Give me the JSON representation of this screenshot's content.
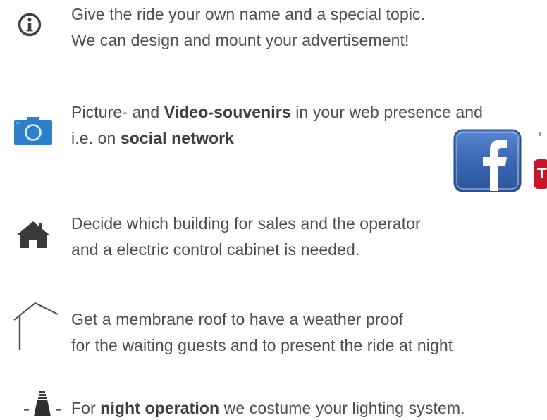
{
  "items": [
    {
      "icon": "info-icon",
      "lines": [
        [
          {
            "t": "Give the ride your own name and a special topic."
          }
        ],
        [
          {
            "t": "We can design and mount your advertisement!"
          }
        ]
      ]
    },
    {
      "icon": "camera-icon",
      "lines": [
        [
          {
            "t": "Picture- and "
          },
          {
            "t": "Video-souvenirs",
            "b": true
          },
          {
            "t": " in your web presence and"
          }
        ],
        [
          {
            "t": "i.e. on "
          },
          {
            "t": "social network",
            "b": true
          }
        ]
      ]
    },
    {
      "icon": "house-icon",
      "lines": [
        [
          {
            "t": "Decide which building for sales and the operator"
          }
        ],
        [
          {
            "t": "and a electric control cabinet is needed."
          }
        ]
      ]
    },
    {
      "icon": "roof-icon",
      "lines": [
        [
          {
            "t": "Get a membrane roof to have a weather proof"
          }
        ],
        [
          {
            "t": "for the waiting guests and to present the ride at night"
          }
        ]
      ]
    },
    {
      "icon": "lamp-icon",
      "lines": [
        [
          {
            "t": "For "
          },
          {
            "t": "night operation",
            "b": true
          },
          {
            "t": " we costume your lighting system."
          }
        ]
      ]
    }
  ],
  "social": {
    "facebook_icon": "facebook-logo-icon",
    "second_icon": "red-social-logo-icon",
    "facebook_letter": "f",
    "second_letter": "T"
  },
  "colors": {
    "text": "#4d4d4d",
    "icon": "#3f3f3f",
    "camera": "#2f7fc8",
    "facebook": "#3b68b4",
    "red_logo": "#c4182a"
  }
}
